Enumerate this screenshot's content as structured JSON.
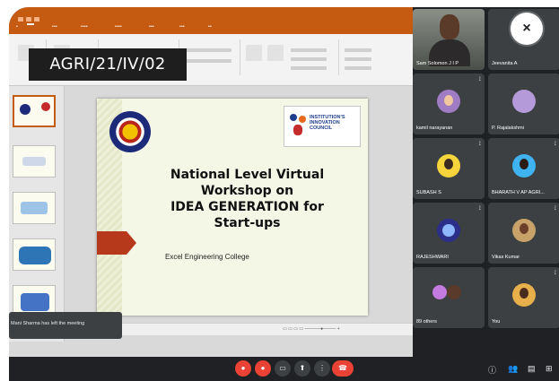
{
  "overlay_label": "AGRI/21/IV/02",
  "slide": {
    "title_lines": [
      "National Level Virtual",
      "Workshop on",
      "IDEA GENERATION for",
      "Start-ups"
    ],
    "college": "Excel Engineering College",
    "iic_logo_text": [
      "INSTITUTION'S",
      "INNOVATION",
      "COUNCIL"
    ]
  },
  "participants": [
    {
      "name": "Sam Solomon J I P",
      "video": true
    },
    {
      "name": "Jeevanita A"
    },
    {
      "name": "kamil narayanan"
    },
    {
      "name": "P. Rajalakshmi"
    },
    {
      "name": "SUBASH S"
    },
    {
      "name": "BHARATH V AP AGRI..."
    },
    {
      "name": "RAJESHWARI"
    },
    {
      "name": "Vikas Kumar"
    },
    {
      "name": "89 others"
    },
    {
      "name": "You"
    }
  ],
  "toast": "Mani Sharma has left the meeting",
  "icons": {
    "close": "close-icon",
    "mic": "mic-off-icon",
    "camera": "camera-off-icon",
    "captions": "captions-icon",
    "present": "present-icon",
    "more": "more-options-icon",
    "end": "end-call-icon"
  },
  "colors": {
    "ppt_accent": "#c55a11",
    "meet_bg": "#202124",
    "tile_bg": "#3c4043",
    "danger": "#ea4335"
  }
}
